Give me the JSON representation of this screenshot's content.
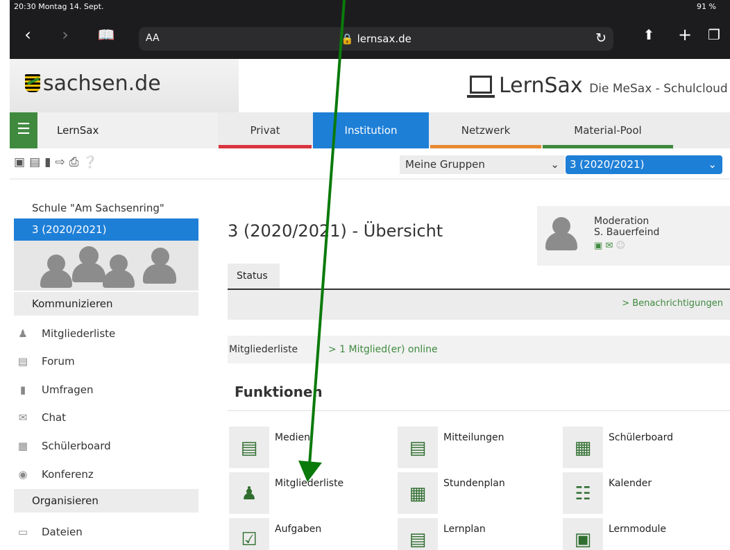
{
  "statusbar": {
    "time": "20:30  Montag 14. Sept.",
    "battery": "91 %"
  },
  "browser": {
    "text_size": "AA",
    "url": "lernsax.de"
  },
  "header": {
    "left_logo": "sachsen.de",
    "app_name": "LernSax",
    "app_subtitle": "Die MeSax - Schulcloud"
  },
  "tabs": {
    "brand": "LernSax",
    "items": [
      {
        "label": "Privat",
        "color": "#d9343f"
      },
      {
        "label": "Institution",
        "color": "#1e7fd7"
      },
      {
        "label": "Netzwerk",
        "color": "#e78a32"
      },
      {
        "label": "Material-Pool",
        "color": "#3f8a3f"
      }
    ]
  },
  "toolbar": {
    "groups_select": "Meine Gruppen",
    "class_select": "3 (2020/2021)"
  },
  "sidebar": {
    "school": "Schule \"Am Sachsenring\"",
    "class": "3 (2020/2021)",
    "section_communicate": "Kommunizieren",
    "communicate_items": [
      {
        "label": "Mitgliederliste",
        "icon": "members-icon"
      },
      {
        "label": "Forum",
        "icon": "forum-icon"
      },
      {
        "label": "Umfragen",
        "icon": "poll-icon"
      },
      {
        "label": "Chat",
        "icon": "chat-icon"
      },
      {
        "label": "Schülerboard",
        "icon": "board-icon"
      },
      {
        "label": "Konferenz",
        "icon": "conference-icon"
      }
    ],
    "section_organize": "Organisieren",
    "organize_items": [
      {
        "label": "Dateien",
        "icon": "files-icon"
      }
    ]
  },
  "main": {
    "title": "3 (2020/2021) - Übersicht",
    "moderation_label": "Moderation",
    "moderator": "S. Bauerfeind",
    "status_tab": "Status",
    "notifications_link": "> Benachrichtigungen",
    "members_label": "Mitgliederliste",
    "members_online": "> 1 Mitglied(er) online",
    "functions_title": "Funktionen",
    "functions": [
      {
        "label": "Medien",
        "icon": "media-icon"
      },
      {
        "label": "Mitteilungen",
        "icon": "notes-icon"
      },
      {
        "label": "Schülerboard",
        "icon": "board-icon"
      },
      {
        "label": "Mitgliederliste",
        "icon": "members-icon"
      },
      {
        "label": "Stundenplan",
        "icon": "timetable-icon"
      },
      {
        "label": "Kalender",
        "icon": "calendar-icon"
      },
      {
        "label": "Aufgaben",
        "icon": "tasks-icon"
      },
      {
        "label": "Lernplan",
        "icon": "learning-plan-icon"
      },
      {
        "label": "Lernmodule",
        "icon": "learning-modules-icon"
      }
    ]
  },
  "annotation": {
    "arrow_color": "#0a7a0a"
  }
}
